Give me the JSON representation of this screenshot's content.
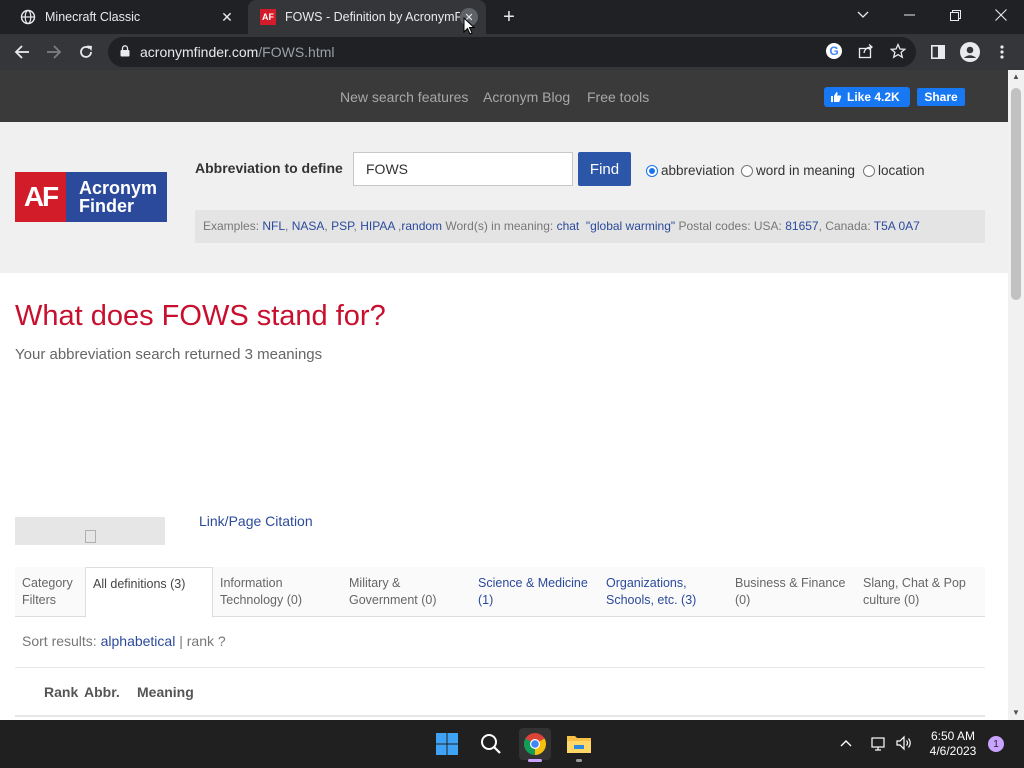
{
  "browser": {
    "tabs": [
      {
        "title": "Minecraft Classic",
        "active": false
      },
      {
        "title": "FOWS - Definition by AcronymFinder",
        "active": true
      }
    ],
    "url_host": "acronymfinder.com",
    "url_path": "/FOWS.html"
  },
  "site": {
    "nav": [
      "New search features",
      "Acronym Blog",
      "Free tools"
    ],
    "fb_like": "Like 4.2K",
    "fb_share": "Share",
    "logo_mark": "AF",
    "logo_line1": "Acronym",
    "logo_line2": "Finder",
    "abbr_label": "Abbreviation to define",
    "search_value": "FOWS",
    "find_label": "Find",
    "radios": [
      {
        "label": "abbreviation",
        "checked": true
      },
      {
        "label": "word in meaning",
        "checked": false
      },
      {
        "label": "location",
        "checked": false
      }
    ],
    "examples": {
      "prefix": "Examples:",
      "abbr_links": [
        "NFL",
        "NASA",
        "PSP",
        "HIPAA",
        "random"
      ],
      "words_label": "Word(s) in meaning:",
      "word_links": [
        "chat",
        "\"global warming\""
      ],
      "postal_label": "Postal codes: USA:",
      "usa_code": "81657",
      "canada_label": "Canada:",
      "canada_code": "T5A 0A7"
    }
  },
  "main": {
    "headline": "What does FOWS stand for?",
    "subhead": "Your abbreviation search returned 3 meanings",
    "citation_link": "Link/Page Citation",
    "category_filters_label": [
      "Category",
      "Filters"
    ],
    "categories": [
      {
        "l1": "All definitions (3)",
        "l2": ""
      },
      {
        "l1": "Information",
        "l2": "Technology (0)"
      },
      {
        "l1": "Military &",
        "l2": "Government (0)"
      },
      {
        "l1": "Science & Medicine",
        "l2": "(1)"
      },
      {
        "l1": "Organizations,",
        "l2": "Schools, etc. (3)"
      },
      {
        "l1": "Business & Finance",
        "l2": "(0)"
      },
      {
        "l1": "Slang, Chat & Pop",
        "l2": "culture (0)"
      }
    ],
    "sort_label": "Sort results:",
    "sort_alpha": "alphabetical",
    "sort_sep": "|",
    "sort_rank": "rank ?",
    "col_rank": "Rank",
    "col_abbr": "Abbr.",
    "col_meaning": "Meaning"
  },
  "taskbar": {
    "time": "6:50 AM",
    "date": "4/6/2023",
    "notification_count": "1"
  }
}
